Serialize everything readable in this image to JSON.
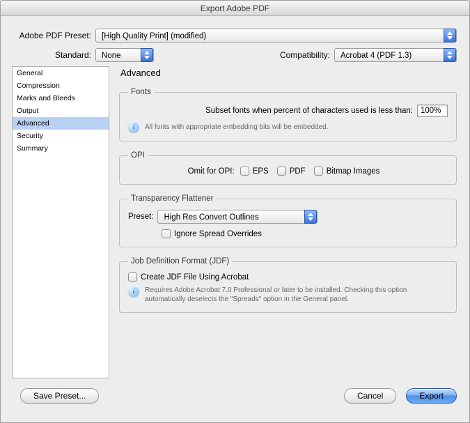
{
  "window": {
    "title": "Export Adobe PDF"
  },
  "preset": {
    "label": "Adobe PDF Preset:",
    "value": "[High Quality Print] (modified)"
  },
  "standard": {
    "label": "Standard:",
    "value": "None"
  },
  "compatibility": {
    "label": "Compatibility:",
    "value": "Acrobat 4 (PDF 1.3)"
  },
  "sidebar": {
    "items": [
      {
        "label": "General"
      },
      {
        "label": "Compression"
      },
      {
        "label": "Marks and Bleeds"
      },
      {
        "label": "Output"
      },
      {
        "label": "Advanced"
      },
      {
        "label": "Security"
      },
      {
        "label": "Summary"
      }
    ],
    "selected_index": 4
  },
  "panel": {
    "title": "Advanced",
    "fonts": {
      "legend": "Fonts",
      "subset_label": "Subset fonts when percent of characters used is less than:",
      "subset_value": "100%",
      "note": "All fonts with appropriate embedding bits will be embedded."
    },
    "opi": {
      "legend": "OPI",
      "omit_label": "Omit for OPI:",
      "eps": "EPS",
      "pdf": "PDF",
      "bitmap": "Bitmap Images"
    },
    "flattener": {
      "legend": "Transparency Flattener",
      "preset_label": "Preset:",
      "preset_value": "High Res Convert Outlines",
      "ignore_label": "Ignore Spread Overrides"
    },
    "jdf": {
      "legend": "Job Definition Format (JDF)",
      "create_label": "Create JDF File Using Acrobat",
      "note": "Requires Adobe Acrobat 7.0 Professional or later to be installed. Checking this option automatically deselects the \"Spreads\" option in the General panel."
    }
  },
  "footer": {
    "save_preset": "Save Preset...",
    "cancel": "Cancel",
    "export": "Export"
  }
}
